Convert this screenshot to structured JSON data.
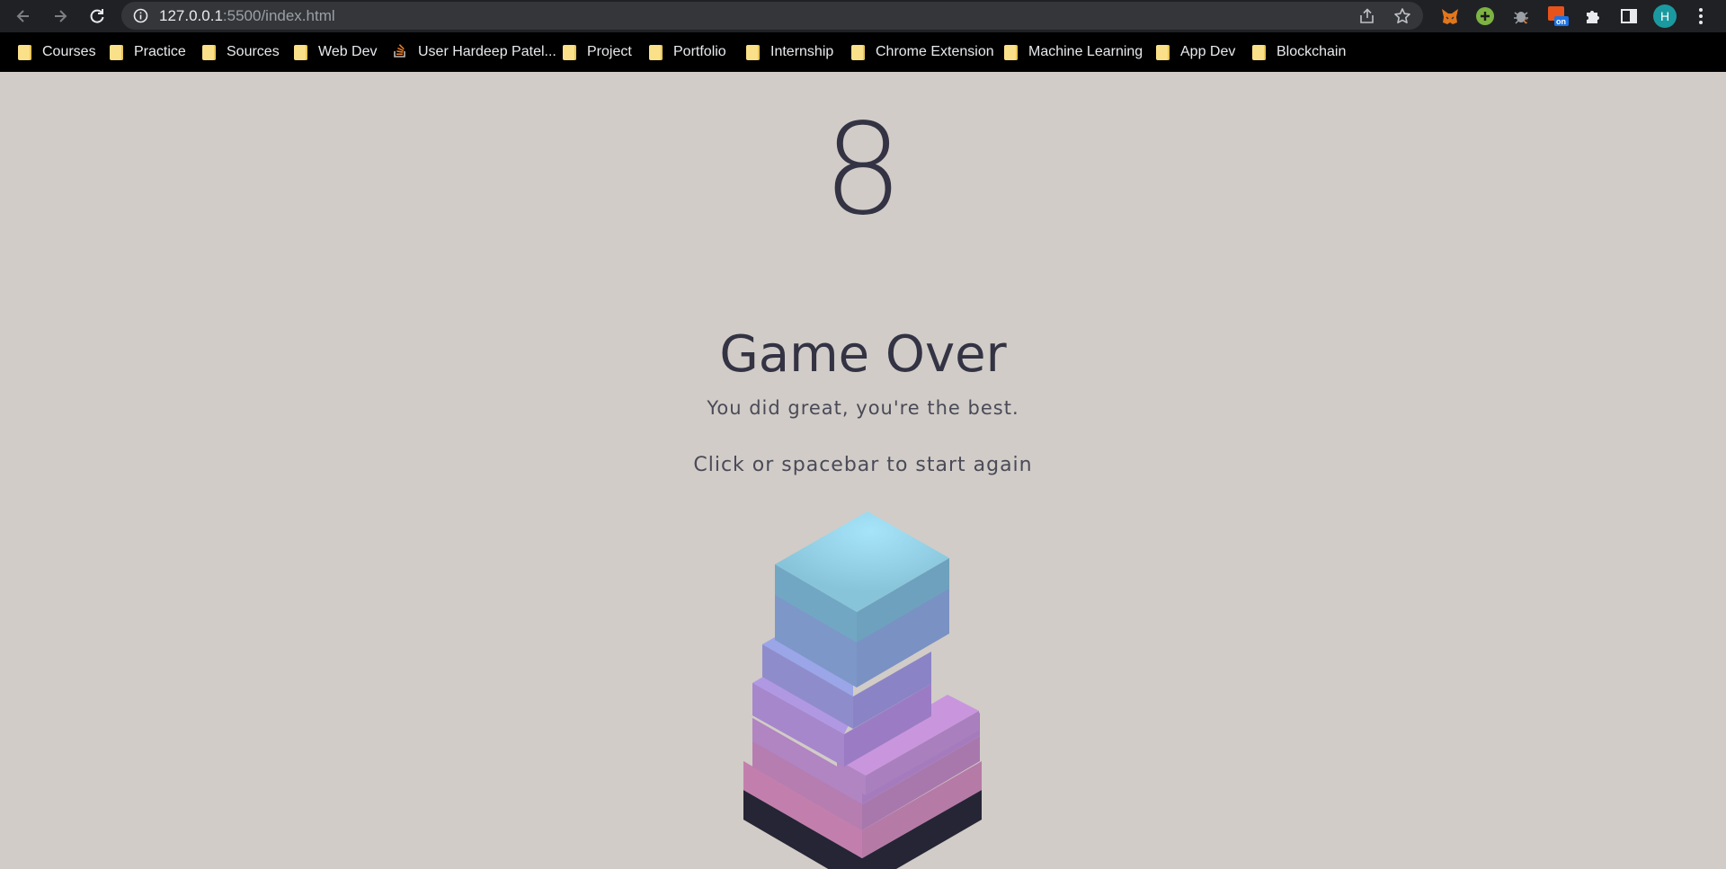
{
  "browser": {
    "url_host": "127.0.0.1",
    "url_path": ":5500/index.html",
    "profile_initial": "H",
    "ext_badge": "on",
    "colors": {
      "profile": "#1a9aa0",
      "toolbar": "#202124",
      "bookmarks_bar": "#000000"
    }
  },
  "bookmarks": [
    {
      "label": "Courses",
      "icon": "folder-icon"
    },
    {
      "label": "Practice",
      "icon": "folder-icon"
    },
    {
      "label": "Sources",
      "icon": "folder-icon"
    },
    {
      "label": "Web Dev",
      "icon": "folder-icon"
    },
    {
      "label": "User Hardeep Patel...",
      "icon": "stackoverflow-icon"
    },
    {
      "label": "Project",
      "icon": "folder-icon"
    },
    {
      "label": "Portfolio",
      "icon": "folder-icon"
    },
    {
      "label": "Internship",
      "icon": "folder-icon"
    },
    {
      "label": "Chrome Extension",
      "icon": "folder-icon"
    },
    {
      "label": "Machine Learning",
      "icon": "folder-icon"
    },
    {
      "label": "App Dev",
      "icon": "folder-icon"
    },
    {
      "label": "Blockchain",
      "icon": "folder-icon"
    }
  ],
  "game": {
    "score": "8",
    "title": "Game Over",
    "subtitle": "You did great, you're the best.",
    "restart": "Click or spacebar to start again",
    "colors": {
      "background": "#d1ccc7",
      "text": "#333344",
      "top_block": "#8fcbe0",
      "base": "#2b2a3a"
    }
  }
}
